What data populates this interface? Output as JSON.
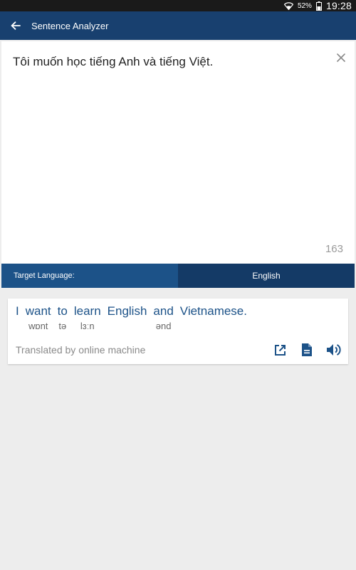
{
  "status_bar": {
    "battery": "52%",
    "time": "19:28"
  },
  "app_bar": {
    "title": "Sentence Analyzer"
  },
  "input": {
    "text": "Tôi muốn học tiếng Anh và tiếng Việt.",
    "char_count": "163"
  },
  "language": {
    "label": "Target Language:",
    "selected": "English"
  },
  "result": {
    "words": [
      {
        "word": "I",
        "phonetic": ""
      },
      {
        "word": "want",
        "phonetic": "wɒnt"
      },
      {
        "word": "to",
        "phonetic": "tə"
      },
      {
        "word": "learn",
        "phonetic": "lɜːn"
      },
      {
        "word": "English",
        "phonetic": ""
      },
      {
        "word": "and",
        "phonetic": "ənd"
      },
      {
        "word": "Vietnamese.",
        "phonetic": ""
      }
    ],
    "credit": "Translated by online machine"
  },
  "icons": {
    "wifi": "wifi-icon",
    "battery": "battery-icon",
    "back": "arrow-back-icon",
    "clear": "close-icon",
    "open": "open-external-icon",
    "document": "document-icon",
    "speaker": "speaker-icon"
  },
  "colors": {
    "app_bar": "#18406f",
    "lang_label_bg": "#1c5288",
    "lang_select_bg": "#143a66",
    "accent_text": "#1c5288"
  }
}
